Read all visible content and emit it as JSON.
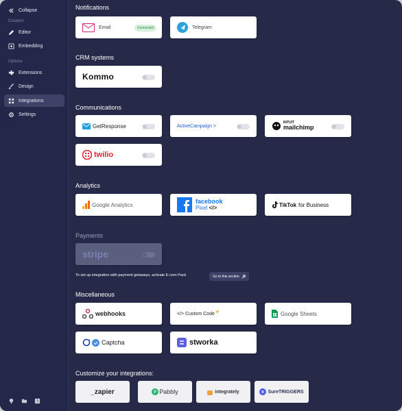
{
  "sidebar": {
    "collapse_label": "Collapse",
    "section_creation": "Creation",
    "section_options": "Options",
    "items": [
      {
        "label": "Editor"
      },
      {
        "label": "Embedding"
      },
      {
        "label": "Extensions"
      },
      {
        "label": "Design"
      },
      {
        "label": "Integrations"
      },
      {
        "label": "Settings"
      }
    ]
  },
  "sections": {
    "notifications": "Notifications",
    "crm": "CRM systems",
    "communications": "Communications",
    "analytics": "Analytics",
    "payments": "Payments",
    "misc": "Miscellaneous",
    "customize": "Customize your integrations:"
  },
  "notifications": {
    "email": {
      "label": "Email",
      "status": "Connected"
    },
    "telegram": {
      "label": "Telegram"
    }
  },
  "crm": {
    "kommo": "Kommo"
  },
  "communications": {
    "getresponse": "GetResponse",
    "activecampaign": "ActiveCampaign >",
    "mailchimp_top": "INTUIT",
    "mailchimp": "mailchimp",
    "twilio": "twilio"
  },
  "analytics": {
    "google": "Google Analytics",
    "facebook_top": "facebook",
    "facebook_bottom": "Pixel",
    "tiktok": "TikTok",
    "tiktok_suffix": "for Business"
  },
  "payments": {
    "stripe": "stripe",
    "note": "To set up integration with payment getaways, activate E-com Pack",
    "link": "Go to this section"
  },
  "misc": {
    "webhooks": "webhooks",
    "custom_code": "</> Custom Code",
    "sheets": "Google Sheets",
    "captcha": "Captcha",
    "stworka": "stworka"
  },
  "customize": {
    "zapier": "_zapier",
    "pabbly": "Pabbly",
    "integrately": "integrately",
    "suretriggers": "SureTRIGGERS"
  },
  "colors": {
    "background": "#262a48",
    "sidebar": "#23274a",
    "active": "#3d4266",
    "card": "#ffffff"
  }
}
